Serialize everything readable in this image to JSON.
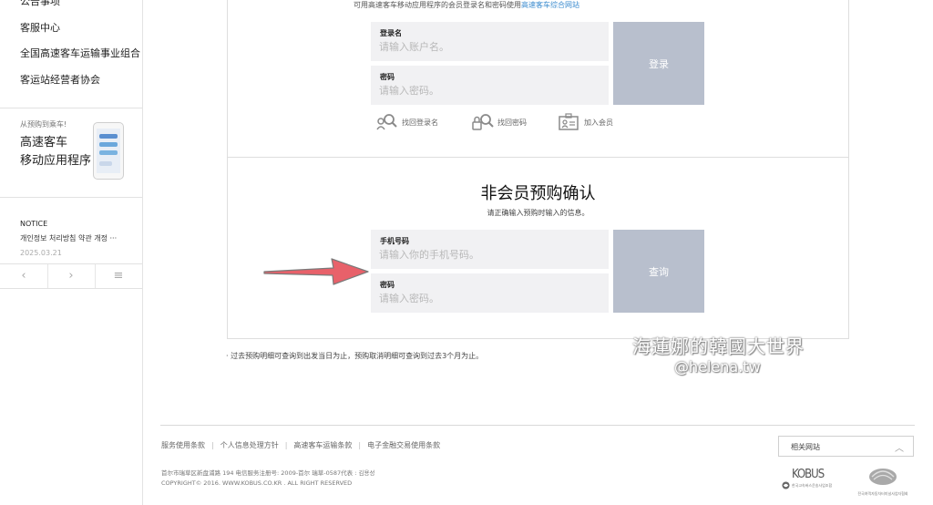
{
  "sidebar": {
    "items": [
      {
        "label": "公告事项"
      },
      {
        "label": "客服中心"
      },
      {
        "label": "全国高速客车运输事业组合"
      },
      {
        "label": "客运站经营者协会"
      }
    ],
    "app_promo": {
      "small": "从预购到乘车!",
      "title_line1": "高速客车",
      "title_line2": "移动应用程序"
    },
    "notice": {
      "heading": "NOTICE",
      "text": "개인정보 처리방침 약관 개정 ···",
      "date": "2025.03.21"
    },
    "pager": {
      "prev": "‹",
      "next": "›",
      "menu": "≡"
    }
  },
  "login": {
    "note_prefix": "可用高速客车移动应用程序的会员登录名和密码使用",
    "note_link": "高速客车综合网站",
    "id_label": "登录名",
    "id_placeholder": "请输入账户名。",
    "pw_label": "密码",
    "pw_placeholder": "请输入密码。",
    "login_button": "登录",
    "find_id": "找回登录名",
    "find_pw": "找回密码",
    "join": "加入会员"
  },
  "nonmember": {
    "title": "非会员预购确认",
    "subtitle": "请正确输入预购时输入的信息。",
    "phone_label": "手机号码",
    "phone_placeholder": "请输入你的手机号码。",
    "pw_label": "密码",
    "pw_placeholder": "请输入密码。",
    "query_button": "查询"
  },
  "note_bottom": "· 过去预购明细可查询到出发当日为止，预购取消明细可查询到过去3个月为止。",
  "watermark": {
    "line1": "海蓮娜的韓國大世界",
    "line2": "@helena.tw"
  },
  "footer": {
    "links": [
      "服务使用条款",
      "个人信息处理方针",
      "高速客车运输条款",
      "电子金融交易使用条款"
    ],
    "address": "首尔市瑞草区新盘浦路 194 电信服务注册号: 2009-首尔 瑞草-0587代表 : 김용성",
    "copyright": "COPYRIGHT© 2016. WWW.KOBUS.CO.KR . ALL RIGHT RESERVED",
    "related_label": "相关网站",
    "related_caret": "︿",
    "kobus_logo": "KOBUS",
    "kobus_sub": "한국고속버스운송사업조합",
    "assoc_sub": "전국여객자동차터미널사업자협회"
  },
  "colors": {
    "button_bg": "#b8bfcd",
    "field_bg": "#f1f1f3",
    "link": "#3c8ccf",
    "arrow": "#e8616a"
  }
}
